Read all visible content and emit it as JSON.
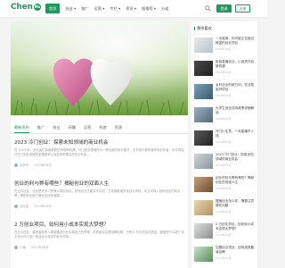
{
  "header": {
    "logo_text": "Chen",
    "logo_mark": "Mo",
    "nav": [
      "首页",
      "创业 ▾",
      "推广",
      "运营 ▾",
      "专栏 ▾",
      "资讯 ▾",
      "搜推荐 ▾",
      "分省"
    ],
    "active_nav_index": 0,
    "search_icon": "search-icon",
    "login_label": "登录",
    "register_label": "注册"
  },
  "main": {
    "tabs": [
      "最新发布",
      "推广",
      "创业",
      "网赚",
      "运营",
      "科普",
      "资源"
    ],
    "active_tab_index": 0,
    "posts": [
      {
        "title": "2023 冷门创业：探索未知领域的商业机会",
        "excerpt": "在 2023 年，创业者们探索着新的市场和机遇。冷门创业领域作为一种全新的商业模式，正在吸引越来越多的创业者，本文将探讨冷门创业领域的发展趋势以及如何把握这些商业机会...",
        "author": "百家号",
        "date": "2023年08月"
      },
      {
        "title": "创业的利与弊有哪些？揭秘创业的双面人生",
        "excerpt": "在当今社会，创业是许多人梦寐以求的目标。然而创业之路并不平坦，它伴随着诸多挑战与风险。本文将深入剖析创业的利与弊，帮助你全面了解创业这条道路...",
        "author": "创业者",
        "date": "2023年08月"
      },
      {
        "title": "2 万创业项目，如何用小成本实现大梦想？",
        "excerpt": "在当今社会，越来越多的人希望通过创业实现自己的梦想，但资金往往是阻碍因素。只有 2 万元的启动资金，能做些什么呢？本文将为你介绍一些适合小成本的创业项目...",
        "author": "小编",
        "date": "2023年08月"
      }
    ]
  },
  "sidebar": {
    "heading": "猜你喜欢",
    "items": [
      {
        "title": "一天能挣，你可能正在错过致富的创业项目",
        "date": "2024年05月"
      },
      {
        "title": "电商直播创业，小投资开启新机遇",
        "date": "2024年05月"
      },
      {
        "title": "乡村创业的新方向，农业致富好项目",
        "date": "2024年05月"
      },
      {
        "title": "大学生创业扶持政策详细解读",
        "date": "2024年05月"
      },
      {
        "title": "冷门小生意，一年能赚不少钱",
        "date": "2024年05月"
      },
      {
        "title": "2023 冷门创业：探索未知领域的商业机会",
        "date": "2024年05月"
      },
      {
        "title": "创业的利与弊有哪些？揭秘创业的双面人生",
        "date": "2024年05月"
      },
      {
        "title": "摆摊创业怎么样，需要注意哪些问题",
        "date": "2024年05月"
      },
      {
        "title": "2 万创业项目，如何用小成本实现大梦想？",
        "date": "2024年05月"
      },
      {
        "title": "加盟创业项目，如何选择靠谱品牌",
        "date": "2024年05月"
      }
    ]
  },
  "colors": {
    "accent": "#1c9c5c",
    "background": "#f4f4f4"
  }
}
